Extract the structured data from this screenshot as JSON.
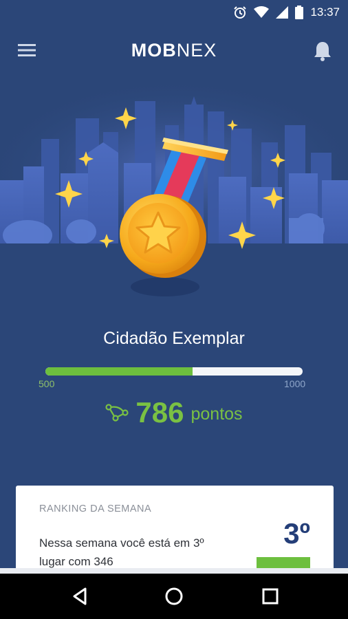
{
  "status_bar": {
    "time": "13:37"
  },
  "app_bar": {
    "logo_bold": "MOB",
    "logo_light": "NEX"
  },
  "badge": {
    "title": "Cidadão Exemplar"
  },
  "progress": {
    "min": "500",
    "max": "1000",
    "current": 786,
    "fill_fraction": 0.572
  },
  "points": {
    "value": "786",
    "unit": "pontos"
  },
  "ranking": {
    "title": "RANKING DA SEMANA",
    "text": "Nessa semana você está em 3º lugar com 346",
    "position": "3º"
  },
  "colors": {
    "background": "#2b4678",
    "accent_green": "#7ac143",
    "ranking_blue": "#243e78"
  },
  "icons": {
    "menu": "hamburger-menu-icon",
    "notifications": "bell-icon",
    "points": "route-icon",
    "alarm": "alarm-icon",
    "wifi": "wifi-icon",
    "signal": "signal-icon",
    "battery": "battery-icon"
  }
}
